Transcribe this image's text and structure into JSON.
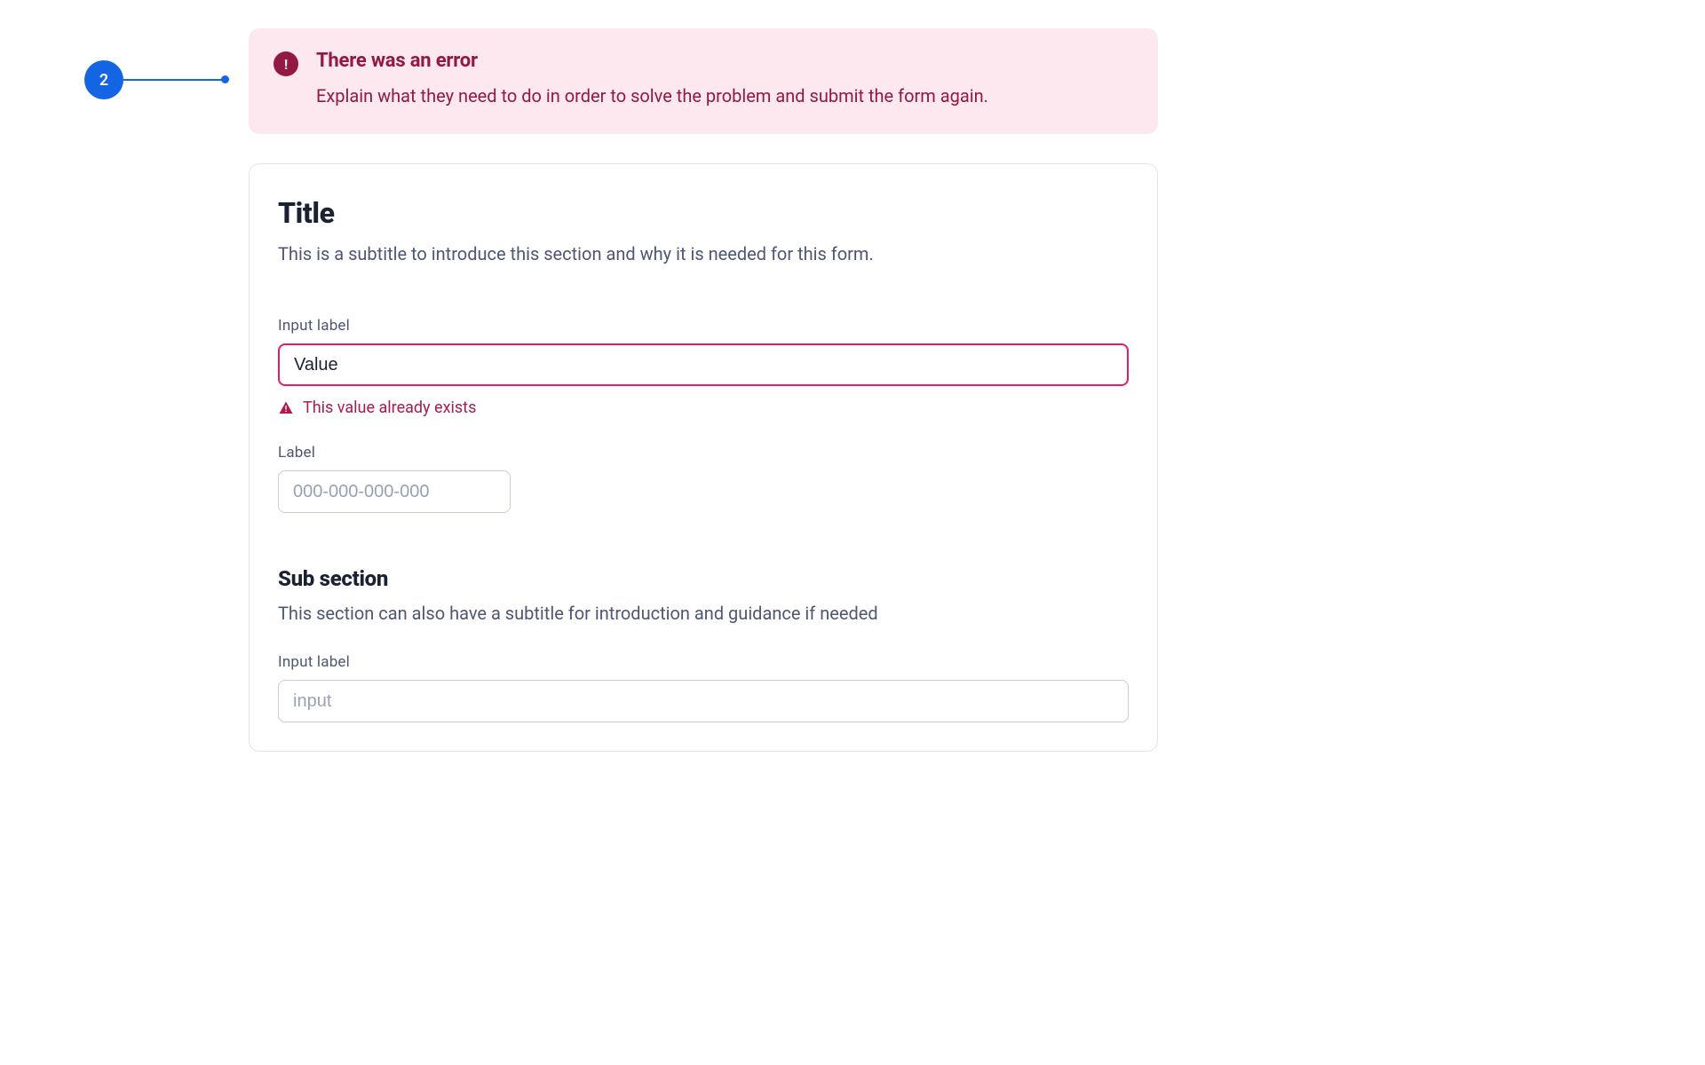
{
  "marker": {
    "number": "2"
  },
  "banner": {
    "title": "There was an error",
    "message": "Explain what they need to do in order to solve the problem and submit the form again."
  },
  "card": {
    "title": "Title",
    "subtitle": "This is a subtitle to introduce this section and why it is needed for this form.",
    "field1": {
      "label": "Input label",
      "value": "Value",
      "error": "This value already exists"
    },
    "field2": {
      "label": "Label",
      "placeholder": "000-000-000-000"
    },
    "subsection": {
      "title": "Sub section",
      "subtitle": "This section can also have a subtitle for introduction and guidance if needed",
      "field": {
        "label": "Input label",
        "placeholder": "input"
      }
    }
  }
}
